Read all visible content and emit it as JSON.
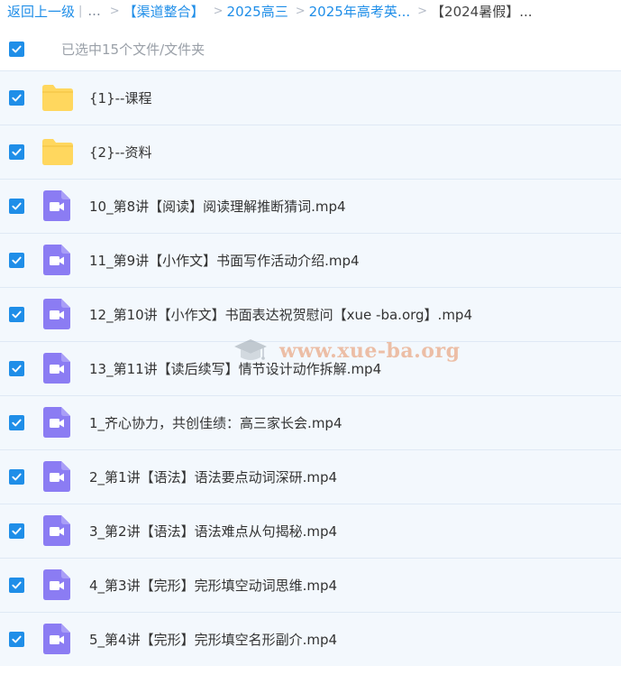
{
  "breadcrumb": {
    "back": "返回上一级",
    "divider": "|",
    "dots": "...",
    "items": [
      "【渠道整合】",
      "2025高三",
      "2025年高考英...",
      "【2024暑假】..."
    ],
    "separator": ">"
  },
  "selection": {
    "label": "已选中15个文件/文件夹",
    "checked": true
  },
  "files": [
    {
      "name": "{1}--课程",
      "type": "folder",
      "checked": true
    },
    {
      "name": "{2}--资料",
      "type": "folder",
      "checked": true
    },
    {
      "name": "10_第8讲【阅读】阅读理解推断猜词.mp4",
      "type": "video",
      "checked": true
    },
    {
      "name": "11_第9讲【小作文】书面写作活动介绍.mp4",
      "type": "video",
      "checked": true
    },
    {
      "name": "12_第10讲【小作文】书面表达祝贺慰问【xue -ba.org】.mp4",
      "type": "video",
      "checked": true
    },
    {
      "name": "13_第11讲【读后续写】情节设计动作拆解.mp4",
      "type": "video",
      "checked": true
    },
    {
      "name": "1_齐心协力，共创佳绩：高三家长会.mp4",
      "type": "video",
      "checked": true
    },
    {
      "name": "2_第1讲【语法】语法要点动词深研.mp4",
      "type": "video",
      "checked": true
    },
    {
      "name": "3_第2讲【语法】语法难点从句揭秘.mp4",
      "type": "video",
      "checked": true
    },
    {
      "name": "4_第3讲【完形】完形填空动词思维.mp4",
      "type": "video",
      "checked": true
    },
    {
      "name": "5_第4讲【完形】完形填空名形副介.mp4",
      "type": "video",
      "checked": true
    }
  ],
  "watermark": {
    "text": "www.xue-ba.org"
  },
  "colors": {
    "accent": "#1f8ee8",
    "folder": "#ffd75e",
    "video": "#8b7cf3",
    "row_bg": "#f3f8fd",
    "row_border": "#dfe9f5"
  },
  "icons": {
    "checkbox": "checkbox-checked-icon",
    "folder": "folder-icon",
    "video": "video-file-icon"
  }
}
